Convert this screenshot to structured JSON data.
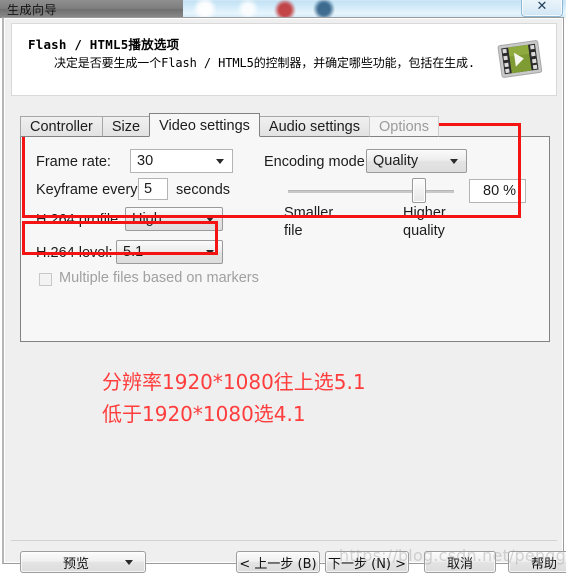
{
  "taskbar": {
    "title": "生成向导"
  },
  "window": {
    "close_glyph": "✕"
  },
  "header": {
    "title": "Flash / HTML5播放选项",
    "subtitle": "决定是否要生成一个Flash / HTML5的控制器，并确定哪些功能，包括在生成.",
    "icon": "video-file-icon"
  },
  "tabs": [
    {
      "label": "Controller",
      "state": "normal"
    },
    {
      "label": "Size",
      "state": "normal"
    },
    {
      "label": "Video settings",
      "state": "active"
    },
    {
      "label": "Audio settings",
      "state": "normal"
    },
    {
      "label": "Options",
      "state": "disabled"
    }
  ],
  "video_settings": {
    "frame_rate": {
      "label": "Frame rate:",
      "value": "30"
    },
    "keyframe": {
      "label": "Keyframe every:",
      "value": "5",
      "unit": "seconds"
    },
    "h264_profile": {
      "label": "H.264 profile:",
      "value": "High"
    },
    "h264_level": {
      "label": "H.264 level:",
      "value": "5.1"
    },
    "multiple_files": {
      "label": "Multiple files based on markers",
      "checked": false
    },
    "encoding_mode": {
      "label": "Encoding mode:",
      "value": "Quality"
    },
    "quality_slider": {
      "value": "80 %",
      "left_label": "Smaller\nfile",
      "right_label": "Higher\nquality",
      "left_label_line1": "Smaller",
      "left_label_line2": "file",
      "right_label_line1": "Higher",
      "right_label_line2": "quality",
      "percent": 80
    }
  },
  "annotations": {
    "highlight_color": "#f51414",
    "note_color": "#ff3d3d",
    "note_line1": "分辨率1920*1080往上选5.1",
    "note_line2": "低于1920*1080选4.1"
  },
  "footer": {
    "preview": "预览",
    "back": "< 上一步 (B)",
    "next": "下一步 (N) >",
    "cancel": "取消",
    "help": "帮助"
  },
  "watermark": {
    "text": "https://blog.csdn.net/penggerhe"
  }
}
